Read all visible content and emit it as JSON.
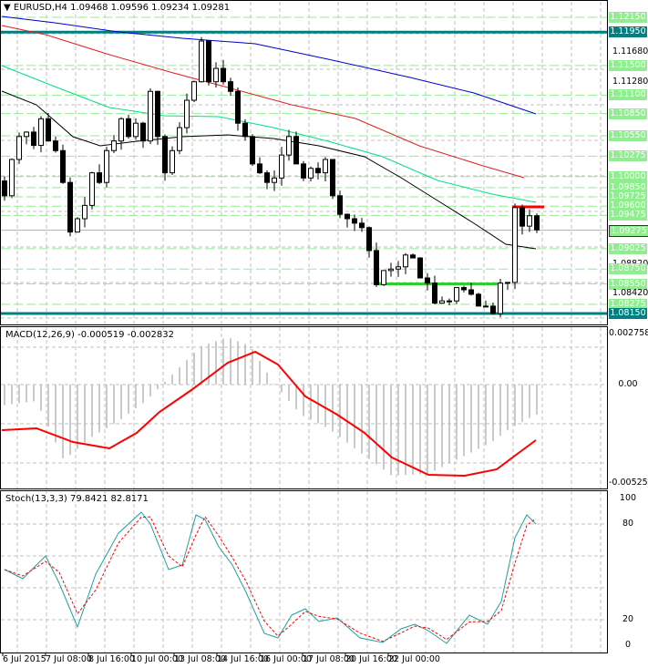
{
  "main": {
    "title": "EURUSD,H4",
    "ohlc": [
      "1.09468",
      "1.09596",
      "1.09234",
      "1.09281"
    ],
    "closes": [
      1.0974,
      1.1023,
      1.1054,
      1.106,
      1.1042,
      1.1078,
      1.1048,
      1.1035,
      1.0992,
      1.0925,
      1.0943,
      1.0961,
      1.1005,
      1.0992,
      1.1035,
      1.1048,
      1.1078,
      1.1054,
      1.1072,
      1.1048,
      1.1115,
      1.1054,
      1.1005,
      1.1035,
      1.1066,
      1.1103,
      1.1128,
      1.1183,
      1.1128,
      1.1146,
      1.1128,
      1.1115,
      1.1072,
      1.1054,
      1.1017,
      1.1005,
      1.0992,
      1.0998,
      1.1029,
      1.1054,
      1.1017,
      1.0998,
      1.1011,
      1.1005,
      1.1023,
      1.0974,
      1.0949,
      1.0943,
      1.0937,
      1.0931,
      1.09,
      1.0854,
      1.0873,
      1.0875,
      1.0878,
      1.0894,
      1.089,
      1.0863,
      1.0856,
      1.0829,
      1.0832,
      1.0832,
      1.085,
      1.0847,
      1.0841,
      1.0825,
      1.0825,
      1.0815,
      1.0856,
      1.0857,
      1.0958,
      1.0933,
      1.0947,
      1.0928
    ],
    "level_labels": [
      {
        "text": "1.12150",
        "price": 1.1215,
        "kind": "green"
      },
      {
        "text": "1.11950",
        "price": 1.1195,
        "kind": "teal"
      },
      {
        "text": "1.11680",
        "price": 1.1168,
        "kind": "tick"
      },
      {
        "text": "1.11500",
        "price": 1.115,
        "kind": "green"
      },
      {
        "text": "1.11280",
        "price": 1.1128,
        "kind": "tick"
      },
      {
        "text": "1.11100",
        "price": 1.111,
        "kind": "green"
      },
      {
        "text": "1.10850",
        "price": 1.1085,
        "kind": "green"
      },
      {
        "text": "1.10550",
        "price": 1.1055,
        "kind": "green"
      },
      {
        "text": "1.10275",
        "price": 1.10275,
        "kind": "green"
      },
      {
        "text": "1.10000",
        "price": 1.1,
        "kind": "green"
      },
      {
        "text": "1.09850",
        "price": 1.0985,
        "kind": "green"
      },
      {
        "text": "1.09725",
        "price": 1.09725,
        "kind": "green"
      },
      {
        "text": "1.09600",
        "price": 1.096,
        "kind": "green"
      },
      {
        "text": "1.09475",
        "price": 1.09475,
        "kind": "green"
      },
      {
        "text": "1.09275",
        "price": 1.09275,
        "kind": "current"
      },
      {
        "text": "1.09025",
        "price": 1.09025,
        "kind": "green"
      },
      {
        "text": "1.08820",
        "price": 1.0882,
        "kind": "tick"
      },
      {
        "text": "1.08750",
        "price": 1.0875,
        "kind": "green"
      },
      {
        "text": "1.08550",
        "price": 1.0855,
        "kind": "green"
      },
      {
        "text": "1.08420",
        "price": 1.0842,
        "kind": "tick"
      },
      {
        "text": "1.08275",
        "price": 1.08275,
        "kind": "green"
      },
      {
        "text": "1.08150",
        "price": 1.0815,
        "kind": "teal"
      }
    ]
  },
  "macd": {
    "title": "MACD(12,26,9) -0.000519 -0.002832",
    "max_label": "0.002758",
    "zero_label": "0.00",
    "min_label": "-0.005253"
  },
  "stoch": {
    "title": "Stoch(13,3,3) 79.8421 82.8171",
    "labels": [
      "100",
      "80",
      "20",
      "0"
    ]
  },
  "time_axis": [
    "6 Jul 2015",
    "7 Jul 08:00",
    "8 Jul 16:00",
    "10 Jul 00:00",
    "13 Jul 08:00",
    "14 Jul 16:00",
    "16 Jul 00:00",
    "17 Jul 08:00",
    "20 Jul 16:00",
    "22 Jul 00:00"
  ],
  "colors": {
    "green_level": "#90ee90",
    "teal_level": "#008080",
    "support": "#32cd32",
    "resistance": "#ff0000",
    "ma_blue": "#0000cd",
    "ma_red": "#e02020",
    "ma_green": "#00e08a",
    "ma_black": "#000000"
  }
}
